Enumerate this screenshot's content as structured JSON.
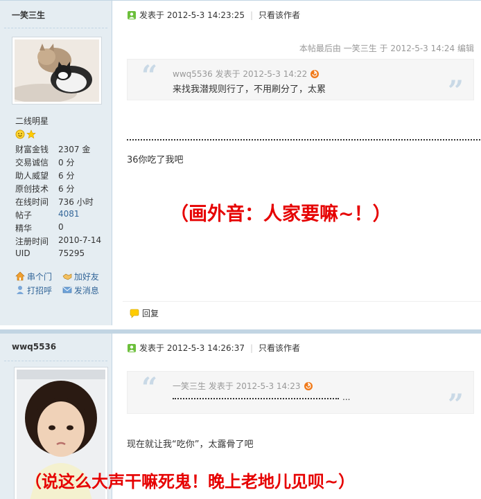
{
  "post1": {
    "username": "一笑三生",
    "rank": "二线明星",
    "stats": [
      {
        "k": "财富金钱",
        "v": "2307 金"
      },
      {
        "k": "交易诚信",
        "v": "0 分"
      },
      {
        "k": "助人威望",
        "v": "6 分"
      },
      {
        "k": "原创技术",
        "v": "6 分"
      },
      {
        "k": "在线时间",
        "v": "736 小时"
      },
      {
        "k": "帖子",
        "v": "4081"
      },
      {
        "k": "精华",
        "v": "0"
      },
      {
        "k": "注册时间",
        "v": "2010-7-14"
      },
      {
        "k": "UID",
        "v": "75295"
      }
    ],
    "actions": {
      "visit": "串个门",
      "add_friend": "加好友",
      "greet": "打招呼",
      "message": "发消息"
    },
    "posted": "发表于 2012-5-3 14:23:25",
    "only_author": "只看该作者",
    "edit_note": "本帖最后由 一笑三生 于 2012-5-3 14:24 编辑",
    "quote_head": "wwq5536 发表于 2012-5-3 14:22",
    "quote_body": "来找我潜规则行了，不用刷分了，太累",
    "content": "36你吃了我吧",
    "overlay": "（画外音：人家要嘛~！）",
    "reply": "回复"
  },
  "post2": {
    "username": "wwq5536",
    "posted": "发表于 2012-5-3 14:26:37",
    "only_author": "只看该作者",
    "quote_head": "一笑三生 发表于 2012-5-3 14:23",
    "quote_tail": "...",
    "content": "现在就让我“吃你”，太露骨了吧",
    "overlay": "（说这么大声干嘛死鬼！晚上老地儿见呗~）"
  },
  "colors": {
    "side_bg": "#e5edf2",
    "border": "#c2d5e3",
    "link": "#336699",
    "overlay_red": "#e60000"
  }
}
